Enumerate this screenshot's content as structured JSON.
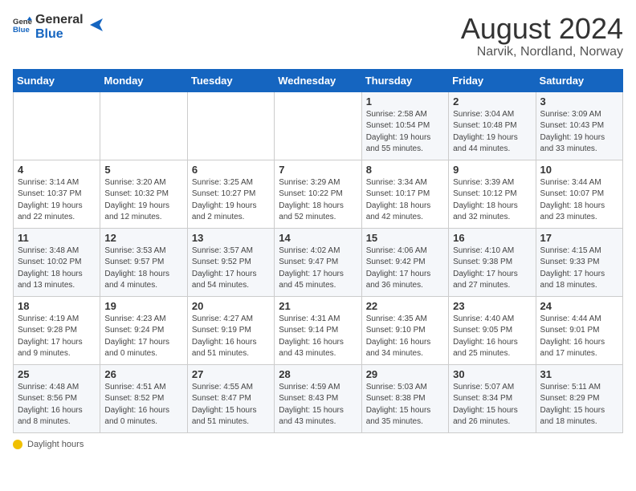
{
  "header": {
    "logo_general": "General",
    "logo_blue": "Blue",
    "title": "August 2024",
    "subtitle": "Narvik, Nordland, Norway"
  },
  "calendar": {
    "days_of_week": [
      "Sunday",
      "Monday",
      "Tuesday",
      "Wednesday",
      "Thursday",
      "Friday",
      "Saturday"
    ],
    "weeks": [
      [
        {
          "day": "",
          "info": ""
        },
        {
          "day": "",
          "info": ""
        },
        {
          "day": "",
          "info": ""
        },
        {
          "day": "",
          "info": ""
        },
        {
          "day": "1",
          "info": "Sunrise: 2:58 AM\nSunset: 10:54 PM\nDaylight: 19 hours\nand 55 minutes."
        },
        {
          "day": "2",
          "info": "Sunrise: 3:04 AM\nSunset: 10:48 PM\nDaylight: 19 hours\nand 44 minutes."
        },
        {
          "day": "3",
          "info": "Sunrise: 3:09 AM\nSunset: 10:43 PM\nDaylight: 19 hours\nand 33 minutes."
        }
      ],
      [
        {
          "day": "4",
          "info": "Sunrise: 3:14 AM\nSunset: 10:37 PM\nDaylight: 19 hours\nand 22 minutes."
        },
        {
          "day": "5",
          "info": "Sunrise: 3:20 AM\nSunset: 10:32 PM\nDaylight: 19 hours\nand 12 minutes."
        },
        {
          "day": "6",
          "info": "Sunrise: 3:25 AM\nSunset: 10:27 PM\nDaylight: 19 hours\nand 2 minutes."
        },
        {
          "day": "7",
          "info": "Sunrise: 3:29 AM\nSunset: 10:22 PM\nDaylight: 18 hours\nand 52 minutes."
        },
        {
          "day": "8",
          "info": "Sunrise: 3:34 AM\nSunset: 10:17 PM\nDaylight: 18 hours\nand 42 minutes."
        },
        {
          "day": "9",
          "info": "Sunrise: 3:39 AM\nSunset: 10:12 PM\nDaylight: 18 hours\nand 32 minutes."
        },
        {
          "day": "10",
          "info": "Sunrise: 3:44 AM\nSunset: 10:07 PM\nDaylight: 18 hours\nand 23 minutes."
        }
      ],
      [
        {
          "day": "11",
          "info": "Sunrise: 3:48 AM\nSunset: 10:02 PM\nDaylight: 18 hours\nand 13 minutes."
        },
        {
          "day": "12",
          "info": "Sunrise: 3:53 AM\nSunset: 9:57 PM\nDaylight: 18 hours\nand 4 minutes."
        },
        {
          "day": "13",
          "info": "Sunrise: 3:57 AM\nSunset: 9:52 PM\nDaylight: 17 hours\nand 54 minutes."
        },
        {
          "day": "14",
          "info": "Sunrise: 4:02 AM\nSunset: 9:47 PM\nDaylight: 17 hours\nand 45 minutes."
        },
        {
          "day": "15",
          "info": "Sunrise: 4:06 AM\nSunset: 9:42 PM\nDaylight: 17 hours\nand 36 minutes."
        },
        {
          "day": "16",
          "info": "Sunrise: 4:10 AM\nSunset: 9:38 PM\nDaylight: 17 hours\nand 27 minutes."
        },
        {
          "day": "17",
          "info": "Sunrise: 4:15 AM\nSunset: 9:33 PM\nDaylight: 17 hours\nand 18 minutes."
        }
      ],
      [
        {
          "day": "18",
          "info": "Sunrise: 4:19 AM\nSunset: 9:28 PM\nDaylight: 17 hours\nand 9 minutes."
        },
        {
          "day": "19",
          "info": "Sunrise: 4:23 AM\nSunset: 9:24 PM\nDaylight: 17 hours\nand 0 minutes."
        },
        {
          "day": "20",
          "info": "Sunrise: 4:27 AM\nSunset: 9:19 PM\nDaylight: 16 hours\nand 51 minutes."
        },
        {
          "day": "21",
          "info": "Sunrise: 4:31 AM\nSunset: 9:14 PM\nDaylight: 16 hours\nand 43 minutes."
        },
        {
          "day": "22",
          "info": "Sunrise: 4:35 AM\nSunset: 9:10 PM\nDaylight: 16 hours\nand 34 minutes."
        },
        {
          "day": "23",
          "info": "Sunrise: 4:40 AM\nSunset: 9:05 PM\nDaylight: 16 hours\nand 25 minutes."
        },
        {
          "day": "24",
          "info": "Sunrise: 4:44 AM\nSunset: 9:01 PM\nDaylight: 16 hours\nand 17 minutes."
        }
      ],
      [
        {
          "day": "25",
          "info": "Sunrise: 4:48 AM\nSunset: 8:56 PM\nDaylight: 16 hours\nand 8 minutes."
        },
        {
          "day": "26",
          "info": "Sunrise: 4:51 AM\nSunset: 8:52 PM\nDaylight: 16 hours\nand 0 minutes."
        },
        {
          "day": "27",
          "info": "Sunrise: 4:55 AM\nSunset: 8:47 PM\nDaylight: 15 hours\nand 51 minutes."
        },
        {
          "day": "28",
          "info": "Sunrise: 4:59 AM\nSunset: 8:43 PM\nDaylight: 15 hours\nand 43 minutes."
        },
        {
          "day": "29",
          "info": "Sunrise: 5:03 AM\nSunset: 8:38 PM\nDaylight: 15 hours\nand 35 minutes."
        },
        {
          "day": "30",
          "info": "Sunrise: 5:07 AM\nSunset: 8:34 PM\nDaylight: 15 hours\nand 26 minutes."
        },
        {
          "day": "31",
          "info": "Sunrise: 5:11 AM\nSunset: 8:29 PM\nDaylight: 15 hours\nand 18 minutes."
        }
      ]
    ]
  },
  "legend": {
    "daylight_label": "Daylight hours"
  }
}
